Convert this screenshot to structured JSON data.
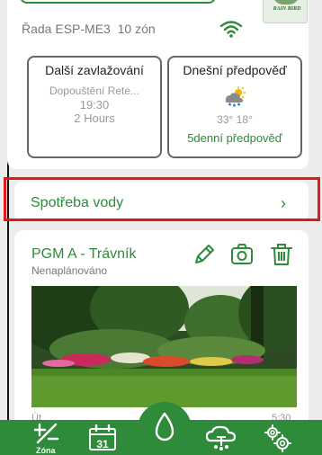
{
  "controller": {
    "name": "Řada ESP-ME3",
    "zones": "10 zón",
    "logo_text": "RAIN BIRD"
  },
  "next_irrigation": {
    "title": "Další zavlažování",
    "program": "Dopouštění Rete...",
    "time": "19:30",
    "duration": "2 Hours"
  },
  "forecast_today": {
    "title": "Dnešní předpověď",
    "temps": "33° 18°",
    "link": "5denní předpověď",
    "icon": "sun-rain-icon"
  },
  "water_usage": {
    "label": "Spotřeba vody",
    "chevron": "›"
  },
  "program": {
    "title": "PGM A - Trávník",
    "status": "Nenaplánováno",
    "day": "Út",
    "time": "5:30"
  },
  "nav": {
    "zone_label": "Zóna",
    "calendar_day": "31"
  },
  "colors": {
    "brand_green": "#2e8b3a",
    "highlight_red": "#e01818"
  }
}
